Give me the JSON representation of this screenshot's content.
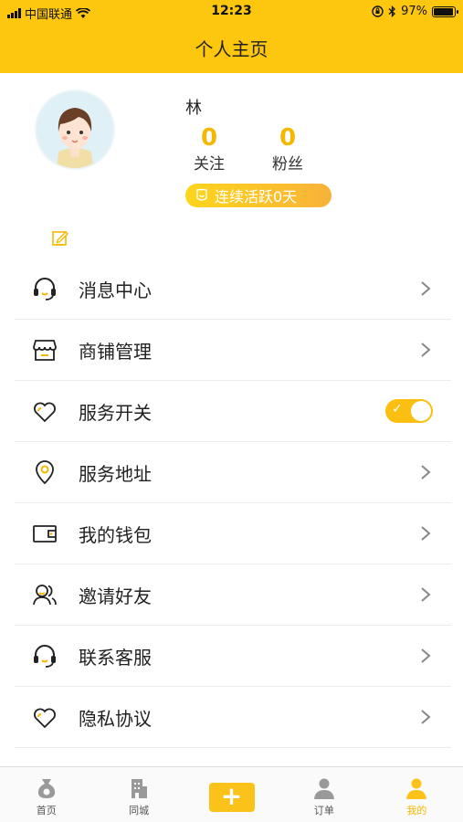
{
  "status_bar": {
    "carrier": "中国联通",
    "time": "12:23",
    "battery": "97%",
    "battery_level": 0.97
  },
  "header": {
    "title": "个人主页"
  },
  "profile": {
    "name": "林",
    "following_count": "0",
    "following_label": "关注",
    "fans_count": "0",
    "fans_label": "粉丝",
    "active_badge": "连续活跃0天"
  },
  "menu": {
    "items": [
      {
        "label": "消息中心",
        "icon": "headset-icon"
      },
      {
        "label": "商铺管理",
        "icon": "shop-icon"
      },
      {
        "label": "服务开关",
        "icon": "heart-icon",
        "toggle_on": true
      },
      {
        "label": "服务地址",
        "icon": "location-pin-icon"
      },
      {
        "label": "我的钱包",
        "icon": "wallet-icon"
      },
      {
        "label": "邀请好友",
        "icon": "friends-icon"
      },
      {
        "label": "联系客服",
        "icon": "headset-icon"
      },
      {
        "label": "隐私协议",
        "icon": "heart-icon"
      }
    ]
  },
  "tabbar": {
    "home_label": "首页",
    "city_label": "同城",
    "add_label": "+",
    "orders_label": "订单",
    "mine_label": "我的"
  },
  "colors": {
    "accent": "#fdc70f",
    "number": "#f5b800"
  }
}
